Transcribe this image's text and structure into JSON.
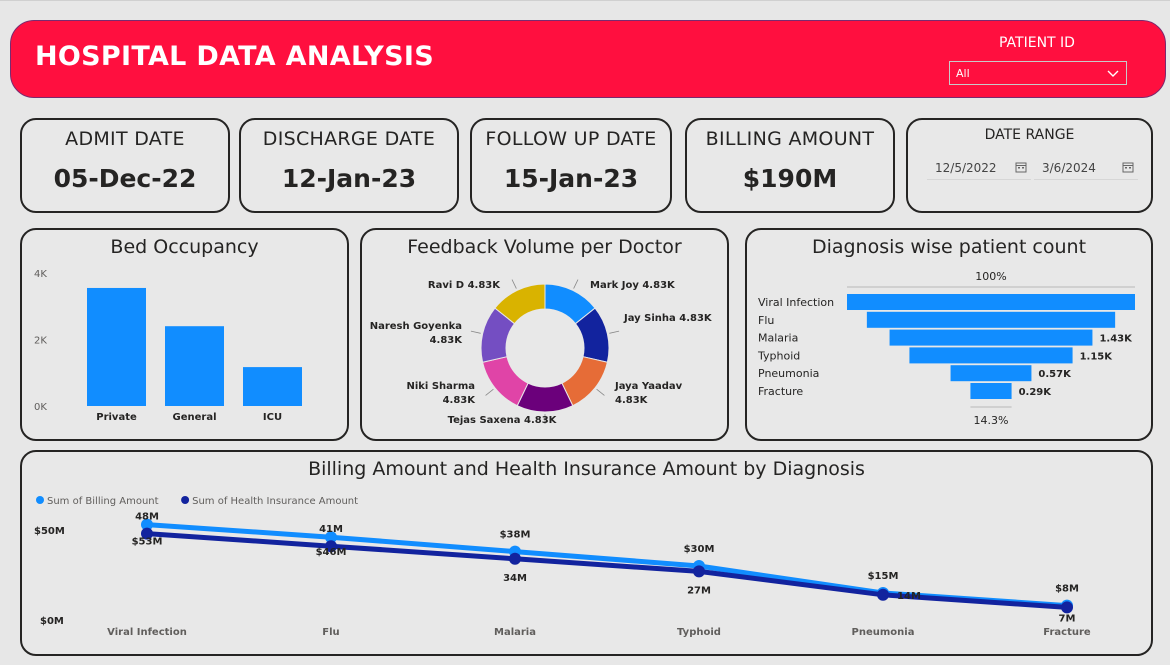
{
  "header": {
    "title": "HOSPITAL DATA ANALYSIS",
    "patient_id_label": "PATIENT ID",
    "patient_id_value": "All"
  },
  "kpis": [
    {
      "label": "ADMIT DATE",
      "value": "05-Dec-22"
    },
    {
      "label": "DISCHARGE DATE",
      "value": "12-Jan-23"
    },
    {
      "label": "FOLLOW UP DATE",
      "value": "15-Jan-23"
    },
    {
      "label": "BILLING AMOUNT",
      "value": "$190M"
    }
  ],
  "date_range": {
    "label": "DATE RANGE",
    "start": "12/5/2022",
    "end": "3/6/2024"
  },
  "colors": {
    "header": "#ff0f3f",
    "blue": "#118dff",
    "navy": "#12239e"
  },
  "chart_data": [
    {
      "type": "bar",
      "title": "Bed Occupancy",
      "categories": [
        "Private",
        "General",
        "ICU"
      ],
      "values": [
        3550,
        2400,
        1170
      ],
      "ylim": [
        0,
        4000
      ],
      "yticks": [
        "0K",
        "2K",
        "4K"
      ],
      "color": "#118dff"
    },
    {
      "type": "pie",
      "title": "Feedback Volume per Doctor",
      "donut": true,
      "slices": [
        {
          "name": "Mark Joy",
          "value": 4.83,
          "label": "Mark Joy 4.83K",
          "color": "#118dff"
        },
        {
          "name": "Jay Sinha",
          "value": 4.83,
          "label": "Jay Sinha 4.83K",
          "color": "#12239e"
        },
        {
          "name": "Jaya Yaadav",
          "value": 4.83,
          "label": "Jaya Yaadav 4.83K",
          "color": "#e66c37"
        },
        {
          "name": "Tejas Saxena",
          "value": 4.83,
          "label": "Tejas Saxena 4.83K",
          "color": "#6b007b"
        },
        {
          "name": "Niki Sharma",
          "value": 4.83,
          "label": "Niki Sharma 4.83K",
          "color": "#e044a7"
        },
        {
          "name": "Naresh Goyenka",
          "value": 4.83,
          "label": "Naresh Goyenka 4.83K",
          "color": "#744ec2"
        },
        {
          "name": "Ravi D",
          "value": 4.83,
          "label": "Ravi D 4.83K",
          "color": "#d9b300"
        }
      ]
    },
    {
      "type": "bar",
      "subtype": "funnel",
      "title": "Diagnosis wise patient count",
      "categories": [
        "Viral Infection",
        "Flu",
        "Malaria",
        "Typhoid",
        "Pneumonia",
        "Fracture"
      ],
      "values": [
        2.03,
        1.75,
        1.43,
        1.15,
        0.57,
        0.29
      ],
      "data_labels": [
        "",
        "",
        "1.43K",
        "1.15K",
        "0.57K",
        "0.29K"
      ],
      "top_percent": "100%",
      "bottom_percent": "14.3%",
      "color": "#118dff"
    },
    {
      "type": "line",
      "title": "Billing Amount and Health Insurance Amount by Diagnosis",
      "categories": [
        "Viral Infection",
        "Flu",
        "Malaria",
        "Typhoid",
        "Pneumonia",
        "Fracture"
      ],
      "ylim": [
        0,
        60
      ],
      "yticks": [
        "$0M",
        "$50M"
      ],
      "series": [
        {
          "name": "Sum of Billing Amount",
          "values": [
            53,
            46,
            38,
            30,
            15,
            8
          ],
          "labels": [
            "$53M",
            "$46M",
            "$38M",
            "$30M",
            "$15M",
            "$8M"
          ],
          "color": "#118dff"
        },
        {
          "name": "Sum of Health Insurance Amount",
          "values": [
            48,
            41,
            34,
            27,
            14,
            7
          ],
          "labels": [
            "48M",
            "41M",
            "34M",
            "27M",
            "14M",
            "7M"
          ],
          "color": "#12239e"
        }
      ]
    }
  ]
}
